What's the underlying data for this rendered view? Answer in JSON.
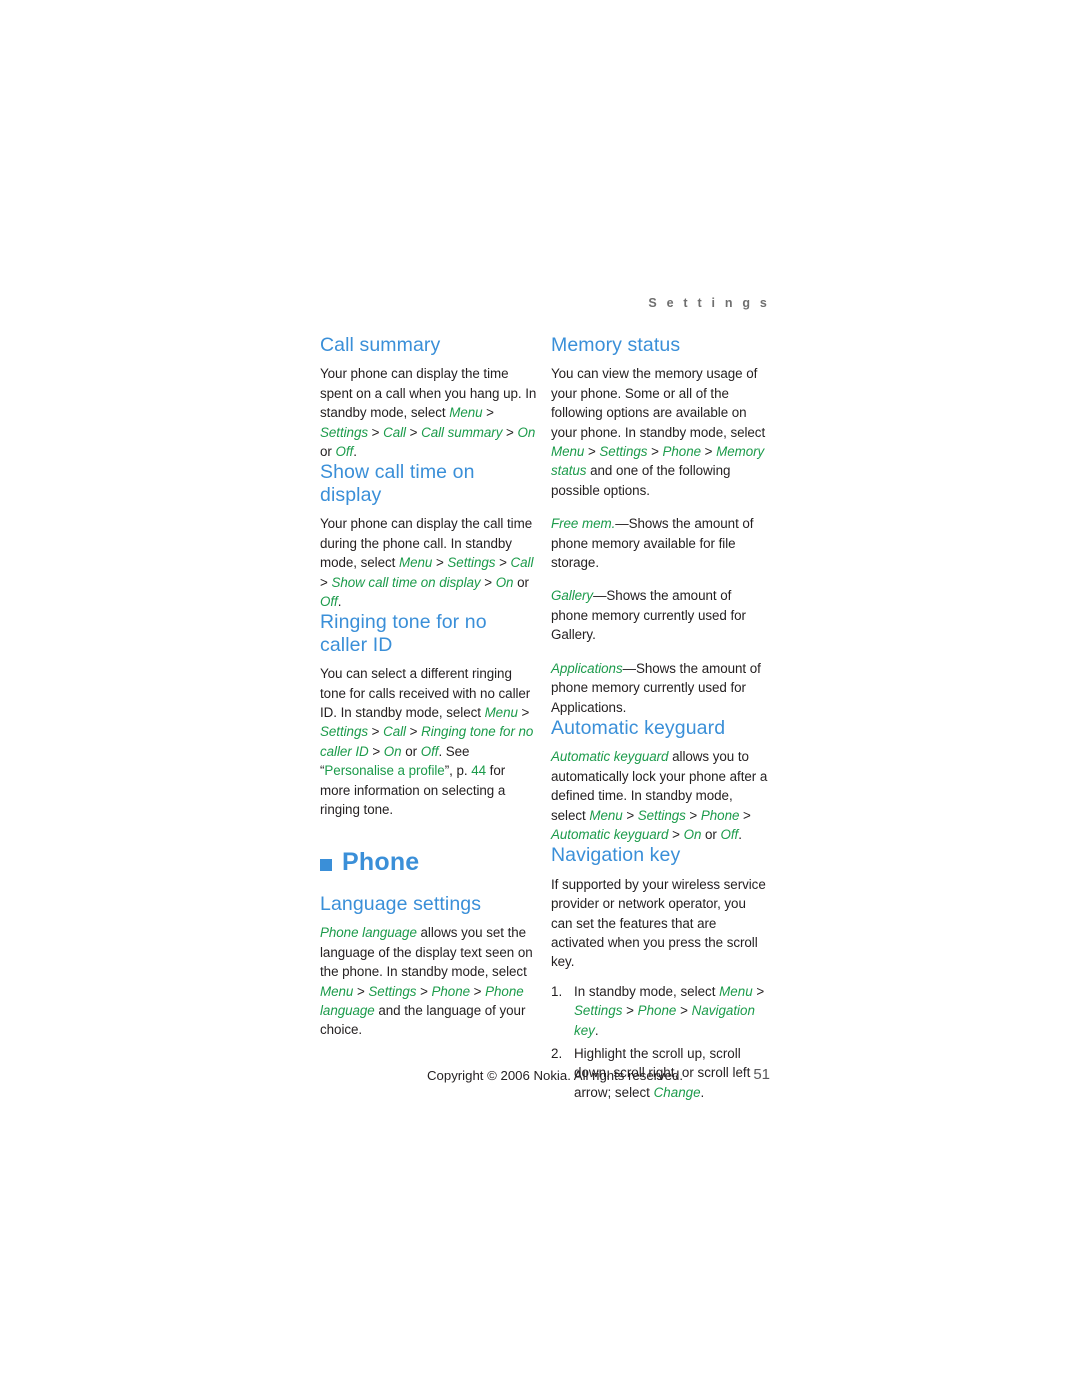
{
  "running_head": "S e t t i n g s",
  "left_column": {
    "sections": [
      {
        "id": "call-summary",
        "heading": "Call summary",
        "paragraphs": [
          [
            {
              "t": "Your phone can display the time spent on a call when you hang up. In standby mode, select ",
              "s": "plain"
            },
            {
              "t": "Menu",
              "s": "green-italic"
            },
            {
              "t": " > ",
              "s": "plain"
            },
            {
              "t": "Settings",
              "s": "green-italic"
            },
            {
              "t": " > ",
              "s": "plain"
            },
            {
              "t": "Call",
              "s": "green-italic"
            },
            {
              "t": " > ",
              "s": "plain"
            },
            {
              "t": "Call summary",
              "s": "green-italic"
            },
            {
              "t": " > ",
              "s": "plain"
            },
            {
              "t": "On",
              "s": "green-italic"
            },
            {
              "t": " or ",
              "s": "plain"
            },
            {
              "t": "Off",
              "s": "green-italic"
            },
            {
              "t": ".",
              "s": "plain"
            }
          ]
        ]
      },
      {
        "id": "show-call-time-on-display",
        "heading": "Show call time on display",
        "paragraphs": [
          [
            {
              "t": "Your phone can display the call time during the phone call. In standby mode, select ",
              "s": "plain"
            },
            {
              "t": "Menu",
              "s": "green-italic"
            },
            {
              "t": " > ",
              "s": "plain"
            },
            {
              "t": "Settings",
              "s": "green-italic"
            },
            {
              "t": " > ",
              "s": "plain"
            },
            {
              "t": "Call",
              "s": "green-italic"
            },
            {
              "t": " > ",
              "s": "plain"
            },
            {
              "t": "Show call time on display",
              "s": "green-italic"
            },
            {
              "t": " > ",
              "s": "plain"
            },
            {
              "t": "On",
              "s": "green-italic"
            },
            {
              "t": " or ",
              "s": "plain"
            },
            {
              "t": "Off",
              "s": "green-italic"
            },
            {
              "t": ".",
              "s": "plain"
            }
          ]
        ]
      },
      {
        "id": "ringing-tone-for-no-caller-id",
        "heading": "Ringing tone for no caller ID",
        "paragraphs": [
          [
            {
              "t": "You can select a different ringing tone for calls received with no caller ID. In standby mode, select ",
              "s": "plain"
            },
            {
              "t": "Menu",
              "s": "green-italic"
            },
            {
              "t": " > ",
              "s": "plain"
            },
            {
              "t": "Settings",
              "s": "green-italic"
            },
            {
              "t": " > ",
              "s": "plain"
            },
            {
              "t": "Call",
              "s": "green-italic"
            },
            {
              "t": " > ",
              "s": "plain"
            },
            {
              "t": "Ringing tone for no caller ID",
              "s": "green-italic"
            },
            {
              "t": " > ",
              "s": "plain"
            },
            {
              "t": "On",
              "s": "green-italic"
            },
            {
              "t": " or ",
              "s": "plain"
            },
            {
              "t": "Off",
              "s": "green-italic"
            },
            {
              "t": ". See “",
              "s": "plain"
            },
            {
              "t": "Personalise a profile",
              "s": "green-plain"
            },
            {
              "t": "”, p. ",
              "s": "plain"
            },
            {
              "t": "44",
              "s": "green-plain"
            },
            {
              "t": " for more information on selecting a ringing tone.",
              "s": "plain"
            }
          ]
        ]
      }
    ],
    "chapter": {
      "title": "Phone",
      "bullet": "square-bullet"
    },
    "sections_after_chapter": [
      {
        "id": "language-settings",
        "heading": "Language settings",
        "paragraphs": [
          [
            {
              "t": "Phone language",
              "s": "green-italic"
            },
            {
              "t": " allows you set the language of the display text seen on the phone. In standby mode, select ",
              "s": "plain"
            },
            {
              "t": "Menu",
              "s": "green-italic"
            },
            {
              "t": " > ",
              "s": "plain"
            },
            {
              "t": "Settings",
              "s": "green-italic"
            },
            {
              "t": " > ",
              "s": "plain"
            },
            {
              "t": "Phone",
              "s": "green-italic"
            },
            {
              "t": " > ",
              "s": "plain"
            },
            {
              "t": "Phone language",
              "s": "green-italic"
            },
            {
              "t": " and the language of your choice.",
              "s": "plain"
            }
          ]
        ]
      }
    ]
  },
  "right_column": {
    "sections": [
      {
        "id": "memory-status",
        "heading": "Memory status",
        "paragraphs": [
          [
            {
              "t": "You can view the memory usage of your phone. Some or all of the following options are available on your phone. In standby mode, select ",
              "s": "plain"
            },
            {
              "t": "Menu",
              "s": "green-italic"
            },
            {
              "t": " > ",
              "s": "plain"
            },
            {
              "t": "Settings",
              "s": "green-italic"
            },
            {
              "t": " > ",
              "s": "plain"
            },
            {
              "t": "Phone",
              "s": "green-italic"
            },
            {
              "t": " > ",
              "s": "plain"
            },
            {
              "t": "Memory status",
              "s": "green-italic"
            },
            {
              "t": " and one of the following possible options.",
              "s": "plain"
            }
          ],
          [
            {
              "t": "Free mem.",
              "s": "green-italic"
            },
            {
              "t": "—Shows the amount of phone memory available for file storage.",
              "s": "plain"
            }
          ],
          [
            {
              "t": "Gallery",
              "s": "green-italic"
            },
            {
              "t": "—Shows the amount of phone memory currently used for Gallery.",
              "s": "plain"
            }
          ],
          [
            {
              "t": "Applications",
              "s": "green-italic"
            },
            {
              "t": "—Shows the amount of phone memory currently used for Applications.",
              "s": "plain"
            }
          ]
        ]
      },
      {
        "id": "automatic-keyguard",
        "heading": "Automatic keyguard",
        "paragraphs": [
          [
            {
              "t": "Automatic keyguard",
              "s": "green-italic"
            },
            {
              "t": " allows you to automatically lock your phone after a defined time. In standby mode, select ",
              "s": "plain"
            },
            {
              "t": "Menu",
              "s": "green-italic"
            },
            {
              "t": " > ",
              "s": "plain"
            },
            {
              "t": "Settings",
              "s": "green-italic"
            },
            {
              "t": " > ",
              "s": "plain"
            },
            {
              "t": "Phone",
              "s": "green-italic"
            },
            {
              "t": " > ",
              "s": "plain"
            },
            {
              "t": "Automatic keyguard",
              "s": "green-italic"
            },
            {
              "t": " > ",
              "s": "plain"
            },
            {
              "t": "On",
              "s": "green-italic"
            },
            {
              "t": " or ",
              "s": "plain"
            },
            {
              "t": "Off",
              "s": "green-italic"
            },
            {
              "t": ".",
              "s": "plain"
            }
          ]
        ]
      },
      {
        "id": "navigation-key",
        "heading": "Navigation key",
        "paragraphs": [
          [
            {
              "t": "If supported by your wireless service provider or network operator, you can set the features that are activated when you press the scroll key.",
              "s": "plain"
            }
          ]
        ],
        "steps": [
          {
            "num": "1.",
            "parts": [
              {
                "t": "In standby mode, select ",
                "s": "plain"
              },
              {
                "t": "Menu",
                "s": "green-italic"
              },
              {
                "t": " > ",
                "s": "plain"
              },
              {
                "t": "Settings",
                "s": "green-italic"
              },
              {
                "t": " > ",
                "s": "plain"
              },
              {
                "t": "Phone",
                "s": "green-italic"
              },
              {
                "t": " > ",
                "s": "plain"
              },
              {
                "t": "Navigation key",
                "s": "green-italic"
              },
              {
                "t": ".",
                "s": "plain"
              }
            ]
          },
          {
            "num": "2.",
            "parts": [
              {
                "t": "Highlight the scroll up, scroll down, scroll right, or scroll left arrow; select ",
                "s": "plain"
              },
              {
                "t": "Change",
                "s": "green-italic"
              },
              {
                "t": ".",
                "s": "plain"
              }
            ]
          }
        ]
      }
    ]
  },
  "footer": {
    "copyright": "Copyright © 2006 Nokia. All rights reserved.",
    "page_number": "51"
  },
  "colors": {
    "heading_blue": "#3a8fd8",
    "ui_green": "#1c9b4b",
    "body_text": "#231f20",
    "running_head": "#6f6f6f"
  }
}
